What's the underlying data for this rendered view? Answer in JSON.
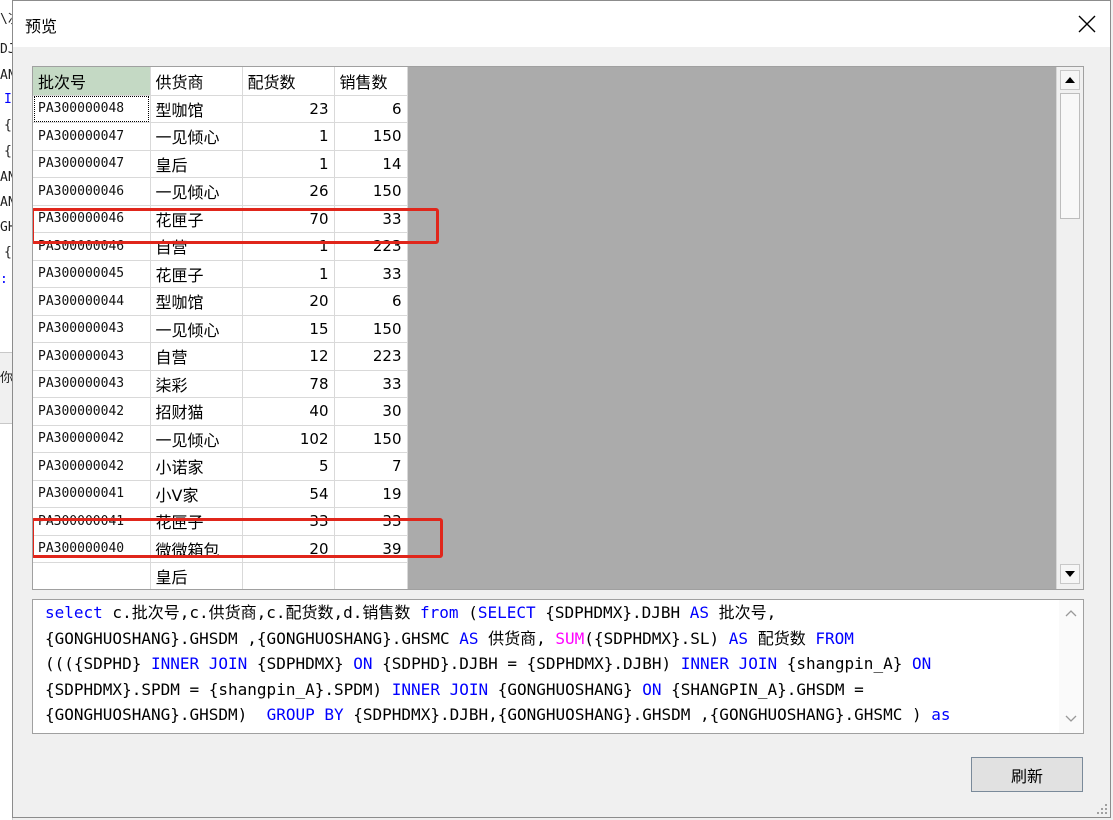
{
  "dialog": {
    "title": "预览",
    "refresh_label": "刷新"
  },
  "background_code_fragments": [
    "\\次",
    "DJ",
    "AN",
    "I",
    "{",
    "{",
    "AN",
    "AN",
    "GH",
    "{",
    ":",
    "你"
  ],
  "grid": {
    "columns": [
      "批次号",
      "供货商",
      "配货数",
      "销售数"
    ],
    "rows": [
      [
        "PA300000048",
        "型咖馆",
        "23",
        "6"
      ],
      [
        "PA300000047",
        "一见倾心",
        "1",
        "150"
      ],
      [
        "PA300000047",
        "皇后",
        "1",
        "14"
      ],
      [
        "PA300000046",
        "一见倾心",
        "26",
        "150"
      ],
      [
        "PA300000046",
        "花匣子",
        "70",
        "33"
      ],
      [
        "PA300000046",
        "自营",
        "1",
        "223"
      ],
      [
        "PA300000045",
        "花匣子",
        "1",
        "33"
      ],
      [
        "PA300000044",
        "型咖馆",
        "20",
        "6"
      ],
      [
        "PA300000043",
        "一见倾心",
        "15",
        "150"
      ],
      [
        "PA300000043",
        "自营",
        "12",
        "223"
      ],
      [
        "PA300000043",
        "柒彩",
        "78",
        "33"
      ],
      [
        "PA300000042",
        "招财猫",
        "40",
        "30"
      ],
      [
        "PA300000042",
        "一见倾心",
        "102",
        "150"
      ],
      [
        "PA300000042",
        "小诺家",
        "5",
        "7"
      ],
      [
        "PA300000041",
        "小V家",
        "54",
        "19"
      ],
      [
        "PA300000041",
        "花匣子",
        "33",
        "33"
      ],
      [
        "PA300000040",
        "微微箱包",
        "20",
        "39"
      ],
      [
        "",
        "皇后",
        "",
        ""
      ]
    ]
  },
  "sql": {
    "lines": [
      [
        {
          "t": "select",
          "k": "kw"
        },
        {
          "t": " c.批次号,c.供货商,c.配货数,d.销售数 "
        },
        {
          "t": "from",
          "k": "kw"
        },
        {
          "t": " ("
        },
        {
          "t": "SELECT",
          "k": "kw"
        },
        {
          "t": " {SDPHDMX}.DJBH "
        },
        {
          "t": "AS",
          "k": "kw"
        },
        {
          "t": " 批次号,"
        }
      ],
      [
        {
          "t": "{GONGHUOSHANG}.GHSDM ,{GONGHUOSHANG}.GHSMC "
        },
        {
          "t": "AS",
          "k": "kw"
        },
        {
          "t": " 供货商, "
        },
        {
          "t": "SUM",
          "k": "fn"
        },
        {
          "t": "({SDPHDMX}.SL) "
        },
        {
          "t": "AS",
          "k": "kw"
        },
        {
          "t": " 配货数 "
        },
        {
          "t": "FROM",
          "k": "kw"
        }
      ],
      [
        {
          "t": "((({SDPHD} "
        },
        {
          "t": "INNER JOIN",
          "k": "kw"
        },
        {
          "t": " {SDPHDMX} "
        },
        {
          "t": "ON",
          "k": "kw"
        },
        {
          "t": " {SDPHD}.DJBH = {SDPHDMX}.DJBH) "
        },
        {
          "t": "INNER JOIN",
          "k": "kw"
        },
        {
          "t": " {shangpin_A} "
        },
        {
          "t": "ON",
          "k": "kw"
        }
      ],
      [
        {
          "t": "{SDPHDMX}.SPDM = {shangpin_A}.SPDM) "
        },
        {
          "t": "INNER JOIN",
          "k": "kw"
        },
        {
          "t": " {GONGHUOSHANG} "
        },
        {
          "t": "ON",
          "k": "kw"
        },
        {
          "t": " {SHANGPIN_A}.GHSDM ="
        }
      ],
      [
        {
          "t": "{GONGHUOSHANG}.GHSDM)  "
        },
        {
          "t": "GROUP BY",
          "k": "kw"
        },
        {
          "t": " {SDPHDMX}.DJBH,{GONGHUOSHANG}.GHSDM ,{GONGHUOSHANG}.GHSMC ) "
        },
        {
          "t": "as",
          "k": "kw"
        }
      ]
    ]
  },
  "icons": {
    "close": "close-icon",
    "scroll_up": "arrow-up-icon",
    "scroll_down": "arrow-down-icon",
    "resize": "resize-grip-icon"
  },
  "colors": {
    "highlight": "#e0261b",
    "keyword": "#0000ff",
    "function": "#ff00ff",
    "selected_header": "#c4d9c4"
  }
}
